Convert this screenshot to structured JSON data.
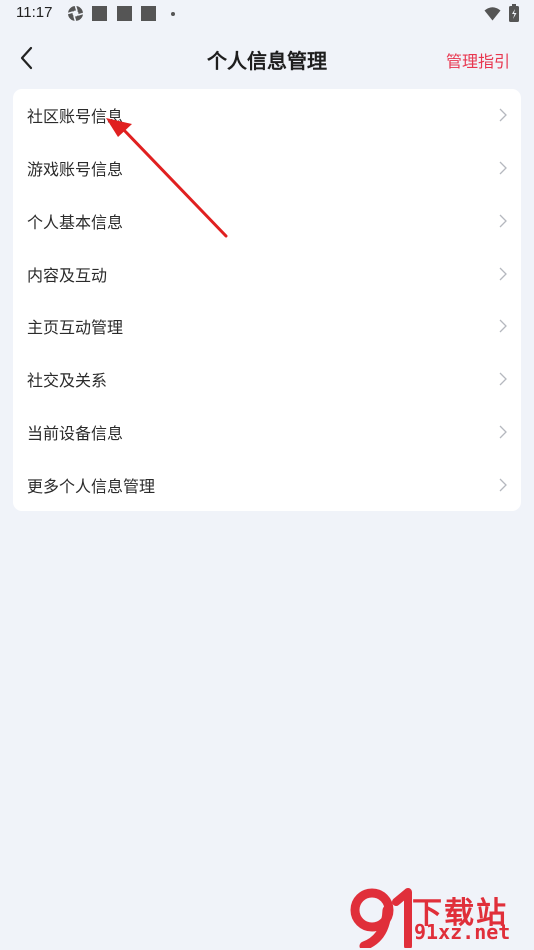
{
  "status_bar": {
    "time": "11:17",
    "icons": [
      "settings-gear-icon",
      "app-square-icon",
      "app-square-icon",
      "app-square-icon",
      "notification-dot-icon",
      "wifi-icon",
      "battery-icon"
    ]
  },
  "header": {
    "title": "个人信息管理",
    "back_icon": "chevron-left-icon",
    "guide_label": "管理指引"
  },
  "menu": {
    "items": [
      {
        "label": "社区账号信息"
      },
      {
        "label": "游戏账号信息"
      },
      {
        "label": "个人基本信息"
      },
      {
        "label": "内容及互动"
      },
      {
        "label": "主页互动管理"
      },
      {
        "label": "社交及关系"
      },
      {
        "label": "当前设备信息"
      },
      {
        "label": "更多个人信息管理"
      }
    ]
  },
  "colors": {
    "accent": "#e8364f",
    "background": "#f0f3f9",
    "card": "#ffffff",
    "annotation_arrow": "#e02020"
  },
  "watermark": {
    "text_cn": "下载站",
    "text_en": "91xz.net"
  }
}
